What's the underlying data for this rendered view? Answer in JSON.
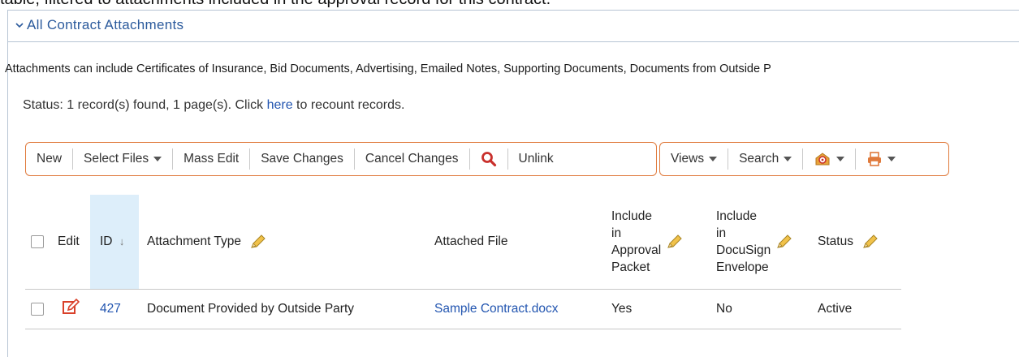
{
  "top_clip_text": "table, filtered to attachments included in the approval record for this contract.",
  "section": {
    "title": "All Contract Attachments"
  },
  "description": "Attachments can include Certificates of Insurance, Bid Documents, Advertising, Emailed Notes, Supporting Documents, Documents from Outside P",
  "status": {
    "prefix": "Status: 1 record(s) found, 1 page(s). Click ",
    "link": "here",
    "suffix": " to recount records."
  },
  "toolbar": {
    "new": "New",
    "select_files": "Select Files",
    "mass_edit": "Mass Edit",
    "save_changes": "Save Changes",
    "cancel_changes": "Cancel Changes",
    "unlink": "Unlink",
    "views": "Views",
    "search": "Search"
  },
  "icons": {
    "search": "magnifier-icon",
    "email": "email-icon",
    "print": "print-icon",
    "edit": "edit-icon",
    "pencil": "pencil-icon"
  },
  "colors": {
    "accent": "#e07a3c",
    "link": "#2255b0",
    "sort_column": "#ddeefa"
  },
  "table": {
    "headers": {
      "edit": "Edit",
      "id": "ID",
      "id_sort": "↓",
      "attachment_type": "Attachment Type",
      "attached_file": "Attached File",
      "approval_1": "Include",
      "approval_2": "in",
      "approval_3": "Approval",
      "approval_4": "Packet",
      "docusign_1": "Include",
      "docusign_2": "in",
      "docusign_3": "DocuSign",
      "docusign_4": "Envelope",
      "status": "Status"
    },
    "rows": [
      {
        "id": "427",
        "attachment_type": "Document Provided by Outside Party",
        "attached_file": "Sample Contract.docx",
        "approval_packet": "Yes",
        "docusign_envelope": "No",
        "status": "Active"
      }
    ]
  }
}
